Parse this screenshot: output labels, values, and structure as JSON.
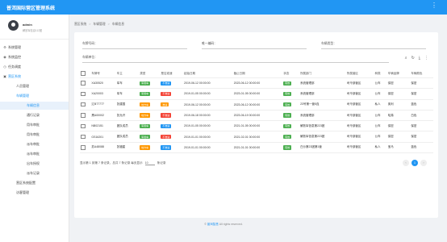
{
  "app": {
    "title": "普洱国际营区管理系统",
    "kebab": "⋮"
  },
  "user": {
    "name": "admin",
    "subtitle": "解放军信息112团"
  },
  "menu": [
    {
      "label": "系统管理"
    },
    {
      "label": "系统监控"
    },
    {
      "label": "任务调度"
    },
    {
      "label": "营区系统"
    },
    {
      "label": "人员管理"
    },
    {
      "label": "车辆管理"
    },
    {
      "label": "车辆信息"
    },
    {
      "label": "通行记录"
    },
    {
      "label": "用车审批"
    },
    {
      "label": "用车审批"
    },
    {
      "label": "派车审批"
    },
    {
      "label": "派车审批"
    },
    {
      "label": "出车授权"
    },
    {
      "label": "派车记录"
    },
    {
      "label": "营区系统配置"
    },
    {
      "label": "访客管理"
    }
  ],
  "breadcrumb": [
    "营区系统",
    "车辆管理",
    "车辆信息"
  ],
  "filters": {
    "plate": "车牌号码：",
    "unit": "唯一编码：",
    "type": "车辆类型：",
    "org": "车辆单位："
  },
  "toolbar": {
    "search": "⌕",
    "refresh": "↻",
    "download": "⤓",
    "more": "⋮"
  },
  "table": {
    "headers": [
      "",
      "车牌号",
      "车主",
      "类型",
      "是否准速",
      "起始日期",
      "截止日期",
      "状态",
      "所属部门",
      "所属营区",
      "种类",
      "车辆品牌",
      "车辆颜色"
    ],
    "rows": [
      [
        "",
        "XA30520",
        "军车",
        "军用车",
        "不准速",
        "2019-06-12 00:00:00",
        "2023-06-12 00:00:00",
        "有效",
        "系统管理部",
        "司令部营区",
        "公车",
        "保密",
        "保密"
      ],
      [
        "",
        "XA20003",
        "军车",
        "军用车",
        "不准速",
        "2019-01-05 00:00:00",
        "2023-01-05 00:00:00",
        "有效",
        "系统管理部",
        "司令部营区",
        "公车",
        "保密",
        "保密"
      ],
      [
        "",
        "辽B77777",
        "张建国",
        "地方车",
        "准速",
        "2019-06-12 00:00:00",
        "2023-06-12 00:00:00",
        "有效",
        "23号第一营5连",
        "司令部营区",
        "私人",
        "奥利",
        "蓝色"
      ],
      [
        "",
        "黑A00002",
        "张允许",
        "地方车",
        "不准速",
        "2019-06-18 00:00:00",
        "2023-06-19 00:00:00",
        "有效",
        "系统管理部",
        "司令部营区",
        "公车",
        "哈弗",
        "白色"
      ],
      [
        "",
        "NB02151",
        "团队成员",
        "军用车",
        "不准速",
        "2019-01-05 00:00:00",
        "2021-01-05 00:00:00",
        "有效",
        "解放军信息第223团",
        "司令部营区",
        "公车",
        "保密",
        "保密"
      ],
      [
        "",
        "GS16201",
        "团队成员",
        "军用车",
        "不准速",
        "2019-01-01 00:00:00",
        "2021-02-01 00:00:00",
        "有效",
        "解放军信息第223团",
        "司令部营区",
        "公车",
        "保密",
        "保密"
      ],
      [
        "",
        "苏A48088",
        "张福星",
        "地方车",
        "不准速",
        "2019-01-01 00:00:00",
        "2021-01-01 00:00:00",
        "有效",
        "白沙第23团第1营",
        "司令部营区",
        "私人",
        "宝马",
        "蓝色"
      ]
    ]
  },
  "pagination": {
    "summary": "显示第 1 到第 7 条记录，总共 7 条记录 每页显示",
    "per_page": "10",
    "suffix": "条记录",
    "prev": "‹",
    "current": "1",
    "next": "›"
  },
  "footer": {
    "copyright_prefix": "© ",
    "brand": "普洱智慧",
    "rest": " All rights reserved."
  },
  "colors": {
    "primary": "#2196f3",
    "green": "#4caf50",
    "orange": "#ff9800",
    "red": "#f44336"
  }
}
